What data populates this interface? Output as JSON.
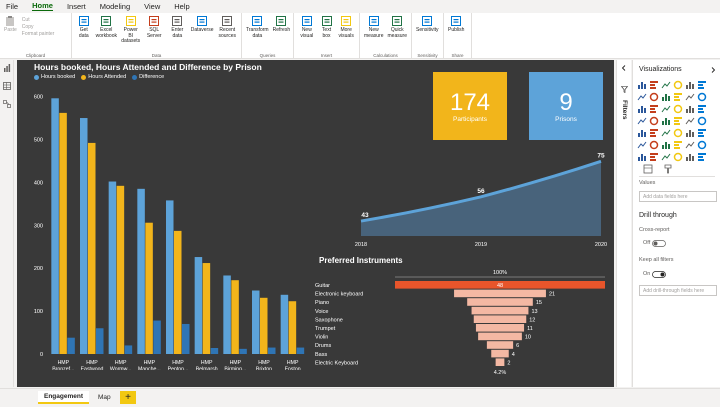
{
  "menu": [
    "File",
    "Home",
    "Insert",
    "Modeling",
    "View",
    "Help"
  ],
  "menu_active": "Home",
  "ribbon": {
    "clipboard": {
      "label": "Clipboard",
      "paste": "Paste",
      "cut": "Cut",
      "copy": "Copy",
      "format_painter": "Format painter"
    },
    "data": {
      "label": "Data",
      "buttons": [
        "Get data",
        "Excel workbook",
        "Power BI datasets",
        "SQL Server",
        "Enter data",
        "Dataverse",
        "Recent sources"
      ]
    },
    "queries": {
      "label": "Queries",
      "buttons": [
        "Transform data",
        "Refresh"
      ]
    },
    "insert": {
      "label": "Insert",
      "buttons": [
        "New visual",
        "Text box",
        "More visuals"
      ]
    },
    "calculations": {
      "label": "Calculations",
      "buttons": [
        "New measure",
        "Quick measure"
      ]
    },
    "sensitivity": {
      "label": "Sensitivity",
      "buttons": [
        "Sensitivity"
      ]
    },
    "share": {
      "label": "Share",
      "buttons": [
        "Publish"
      ]
    }
  },
  "report": {
    "bar_title": "Hours booked, Hours Attended and Difference by Prison",
    "cards": [
      {
        "value": "174",
        "label": "Participants",
        "color": "#f2b51b"
      },
      {
        "value": "9",
        "label": "Prisons",
        "color": "#5da3d9"
      }
    ],
    "instruments_title": "Preferred Instruments"
  },
  "chart_data": [
    {
      "type": "bar",
      "title": "Hours booked, Hours Attended and Difference by Prison",
      "categories": [
        "HMP Bronzef...",
        "HMP Eastwood Park",
        "HMP Wormw... Scrubs",
        "HMP Manche...",
        "HMP Penton...",
        "HMP Belmarsh",
        "HMP Birming...",
        "HMP Brixton",
        "HMP Foston Hall"
      ],
      "series": [
        {
          "name": "Hours booked",
          "color": "#5da3d9",
          "values": [
            596,
            550,
            402,
            385,
            358,
            226,
            183,
            148,
            138
          ]
        },
        {
          "name": "Hours Attended",
          "color": "#f2b51b",
          "values": [
            562,
            492,
            392,
            306,
            287,
            212,
            172,
            131,
            123
          ]
        },
        {
          "name": "Difference",
          "color": "#2f75b5",
          "values": [
            38,
            60,
            20,
            78,
            70,
            14,
            12,
            15,
            15
          ]
        }
      ],
      "yticks": [
        0,
        100,
        200,
        300,
        400,
        500,
        600
      ],
      "ylim": [
        0,
        620
      ],
      "legend": "top-left"
    },
    {
      "type": "area",
      "x": [
        "2018",
        "2019",
        "2020"
      ],
      "values": [
        43,
        56,
        75
      ],
      "ylim": [
        35,
        80
      ],
      "color": "#5da3d9"
    },
    {
      "type": "bar",
      "subtype": "funnel",
      "title": "Preferred Instruments",
      "top_label": "100%",
      "bottom_label": "4.2%",
      "categories": [
        "Guitar",
        "Electronic keyboard",
        "Piano",
        "Voice",
        "Saxophone",
        "Trumpet",
        "Violin",
        "Drums",
        "Bass",
        "Electric Keyboard"
      ],
      "values": [
        48,
        21,
        15,
        13,
        12,
        11,
        10,
        6,
        4,
        2
      ],
      "first_color": "#e8552b",
      "color": "#f4b8a3"
    }
  ],
  "filters_label": "Filters",
  "pane": {
    "title": "Visualizations",
    "values_label": "Values",
    "values_placeholder": "Add data fields here",
    "drill_title": "Drill through",
    "cross_report": "Cross-report",
    "cross_state": "Off",
    "keep_filters": "Keep all filters",
    "keep_state": "On",
    "drill_placeholder": "Add drill-through fields here"
  },
  "tabs": [
    "Engagement",
    "Map"
  ],
  "add_page": "+"
}
